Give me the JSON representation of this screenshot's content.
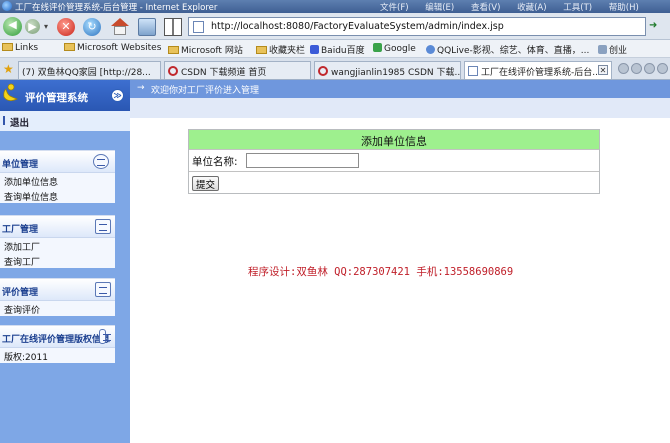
{
  "browser": {
    "window_title": "工厂在线评价管理系统-后台管理 - Internet Explorer",
    "menu": [
      "文件(F)",
      "编辑(E)",
      "查看(V)",
      "收藏(A)",
      "工具(T)",
      "帮助(H)"
    ],
    "address_url": "http://localhost:8080/FactoryEvaluateSystem/admin/index.jsp",
    "links": [
      "Links",
      "Microsoft Websites",
      "Microsoft 网站",
      "收藏夹栏",
      "Baidu百度",
      "Google",
      "QQLive-影视、综艺、体育、直播，...",
      "创业"
    ],
    "tabs": [
      {
        "label": "(7) 双鱼林QQ家园 [http://28...",
        "active": false
      },
      {
        "label": "CSDN 下载频道 首页",
        "active": false
      },
      {
        "label": "wangjianlin1985 CSDN 下载...",
        "active": false
      },
      {
        "label": "工厂在线评价管理系统-后台...",
        "active": true
      }
    ]
  },
  "sidebar": {
    "system_title": "评价管理系统",
    "logout": "退出",
    "groups": [
      {
        "title": "单位管理",
        "items": [
          "添加单位信息",
          "查询单位信息"
        ]
      },
      {
        "title": "工厂管理",
        "items": [
          "添加工厂",
          "查询工厂"
        ]
      },
      {
        "title": "评价管理",
        "items": [
          "查询评价"
        ]
      },
      {
        "title": "工厂在线评价管理版权信息",
        "items": [
          "版权:2011"
        ]
      }
    ]
  },
  "main": {
    "breadcrumb": "欢迎你对工厂评价进入管理",
    "form": {
      "heading": "添加单位信息",
      "name_label": "单位名称:",
      "name_value": "",
      "submit_label": "提交"
    },
    "credit": "程序设计:双鱼林 QQ:287307421 手机:13558690869"
  },
  "colors": {
    "sidebar_bg": "#7ea7e6",
    "form_header_bg": "#9ef08e",
    "credit_text": "#c0202a",
    "breadcrumb_bg": "#6f97dd"
  }
}
